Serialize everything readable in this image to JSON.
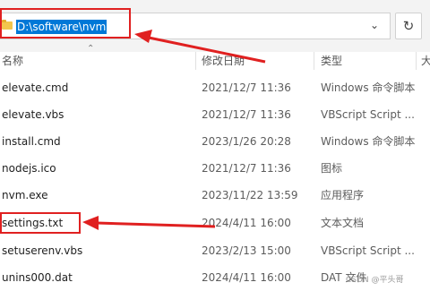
{
  "address_bar": {
    "path": "D:\\software\\nvm",
    "dropdown_icon": "chevron-down-icon",
    "refresh_icon": "refresh-icon"
  },
  "columns": {
    "name": "名称",
    "date": "修改日期",
    "type": "类型",
    "size": "大"
  },
  "files": [
    {
      "name": "elevate.cmd",
      "date": "2021/12/7 11:36",
      "type": "Windows 命令脚本"
    },
    {
      "name": "elevate.vbs",
      "date": "2021/12/7 11:36",
      "type": "VBScript Script ..."
    },
    {
      "name": "install.cmd",
      "date": "2023/1/26 20:28",
      "type": "Windows 命令脚本"
    },
    {
      "name": "nodejs.ico",
      "date": "2021/12/7 11:36",
      "type": "图标"
    },
    {
      "name": "nvm.exe",
      "date": "2023/11/22 13:59",
      "type": "应用程序"
    },
    {
      "name": "settings.txt",
      "date": "2024/4/11 16:00",
      "type": "文本文档"
    },
    {
      "name": "setuserenv.vbs",
      "date": "2023/2/13 15:00",
      "type": "VBScript Script ..."
    },
    {
      "name": "unins000.dat",
      "date": "2024/4/11 16:00",
      "type": "DAT 文件"
    }
  ],
  "watermark": "CSDN @平头哥",
  "colors": {
    "accent": "#0078d7",
    "annotation": "#e02020"
  }
}
